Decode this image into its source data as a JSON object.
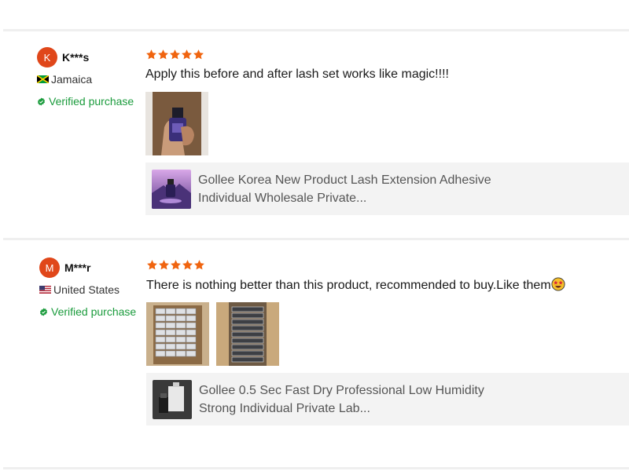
{
  "reviews": [
    {
      "avatar_letter": "K",
      "name": "K***s",
      "country": "Jamaica",
      "verified_label": "Verified purchase",
      "rating": 5,
      "text": "Apply this before and after lash set works like magic!!!!",
      "product": {
        "title_line1": "Gollee Korea New Product Lash Extension Adhesive",
        "title_line2": "Individual Wholesale Private..."
      }
    },
    {
      "avatar_letter": "M",
      "name": "M***r",
      "country": "United States",
      "verified_label": "Verified purchase",
      "rating": 5,
      "text": "There is nothing better than this product, recommended to buy.Like them",
      "product": {
        "title_line1": "Gollee 0.5 Sec Fast Dry Professional Low Humidity",
        "title_line2": "Strong Individual Private Lab..."
      }
    }
  ],
  "colors": {
    "accent_star": "#f0640f",
    "avatar": "#e0471a",
    "verified": "#1a9b3c"
  },
  "icons": [
    "star-icon",
    "verified-badge-icon",
    "jamaica-flag-icon",
    "us-flag-icon",
    "star-struck-emoji-icon"
  ]
}
